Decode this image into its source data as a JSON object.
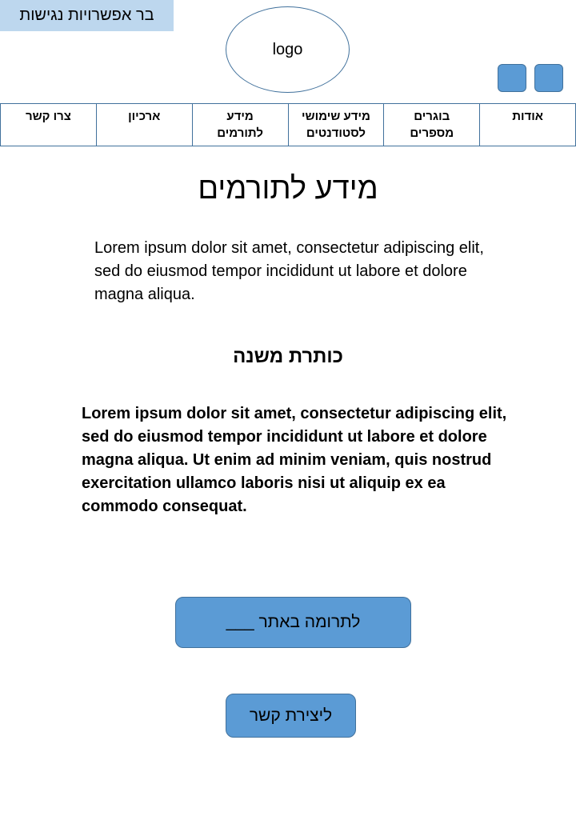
{
  "accessibility_bar": {
    "label": "בר אפשרויות נגישות"
  },
  "logo": {
    "label": "logo"
  },
  "nav": {
    "items": [
      {
        "label": "אודות"
      },
      {
        "label": "בוגרים\nמספרים"
      },
      {
        "label": "מידע שימושי\nלסטודנטים"
      },
      {
        "label": "מידע\nלתורמים"
      },
      {
        "label": "ארכיון"
      },
      {
        "label": "צרו קשר"
      }
    ]
  },
  "main": {
    "title": "מידע לתורמים",
    "intro": "Lorem ipsum dolor sit amet, consectetur adipiscing elit, sed do eiusmod tempor incididunt ut labore et dolore magna aliqua.",
    "subtitle": "כותרת משנה",
    "body": "Lorem ipsum dolor sit amet, consectetur adipiscing elit, sed do eiusmod tempor incididunt ut labore et dolore magna aliqua. Ut enim ad minim veniam, quis nostrud exercitation ullamco laboris nisi ut aliquip ex ea commodo consequat."
  },
  "buttons": {
    "donate_label": "לתרומה באתר ___",
    "contact_label": "ליצירת קשר"
  },
  "colors": {
    "accent": "#5b9bd5",
    "border": "#41719c",
    "access_bar_bg": "#bdd7ee"
  }
}
